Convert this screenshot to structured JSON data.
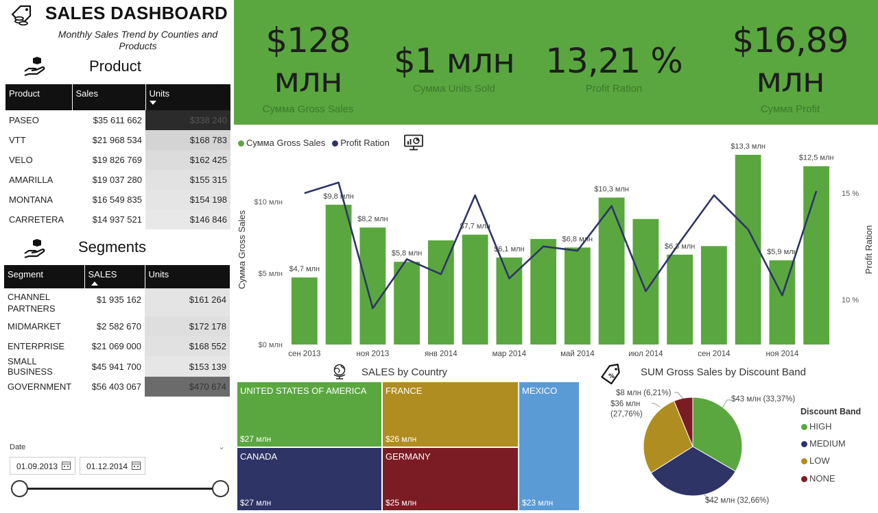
{
  "header": {
    "title": "SALES DASHBOARD",
    "subtitle": "Monthly Sales Trend by Counties and Products"
  },
  "product_section": {
    "title": "Product",
    "columns": [
      "Product",
      "Sales",
      "Units"
    ],
    "rows": [
      {
        "product": "PASEO",
        "sales": "$35 611 662",
        "units": "$338 240"
      },
      {
        "product": "VTT",
        "sales": "$21 968 534",
        "units": "$168 783"
      },
      {
        "product": "VELO",
        "sales": "$19 826 769",
        "units": "$162 425"
      },
      {
        "product": "AMARILLA",
        "sales": "$19 037 280",
        "units": "$155 315"
      },
      {
        "product": "MONTANA",
        "sales": "$16 549 835",
        "units": "$154 198"
      },
      {
        "product": "CARRETERA",
        "sales": "$14 937 521",
        "units": "$146 846"
      }
    ]
  },
  "segment_section": {
    "title": "Segments",
    "columns": [
      "Segment",
      "SALES",
      "Units"
    ],
    "rows": [
      {
        "segment": "CHANNEL PARTNERS",
        "sales": "$1 935 162",
        "units": "$161 264"
      },
      {
        "segment": "MIDMARKET",
        "sales": "$2 582 670",
        "units": "$172 178"
      },
      {
        "segment": "ENTERPRISE",
        "sales": "$21 069 000",
        "units": "$168 552"
      },
      {
        "segment": "SMALL BUSINESS",
        "sales": "$45 941 700",
        "units": "$153 139"
      },
      {
        "segment": "GOVERNMENT",
        "sales": "$56 403 067",
        "units": "$470 674"
      }
    ]
  },
  "date_slicer": {
    "label": "Date",
    "start": "01.09.2013",
    "end": "01.12.2014"
  },
  "kpis": [
    {
      "value_line1": "$128",
      "value_line2": "млн",
      "label": "Сумма Gross Sales"
    },
    {
      "value_line1": "$1 млн",
      "value_line2": "",
      "label": "Сумма Units Sold"
    },
    {
      "value_line1": "13,21 %",
      "value_line2": "",
      "label": "Profit Ration"
    },
    {
      "value_line1": "$16,89",
      "value_line2": "млн",
      "label": "Сумма Profit"
    }
  ],
  "colors": {
    "green": "#5aa73f",
    "navy": "#2e3466",
    "gold": "#b08d20",
    "maroon": "#7b1c24",
    "blue": "#5b9bd5"
  },
  "chart_data": [
    {
      "type": "bar+line",
      "legend": [
        "Сумма Gross Sales",
        "Profit Ration"
      ],
      "ylabel": "Сумма Gross Sales",
      "y2label": "Profit Ration",
      "y_ticks": [
        "$0 млн",
        "$5 млн",
        "$10 млн"
      ],
      "y2_ticks": [
        "10 %",
        "15 %"
      ],
      "ylim": [
        0,
        13.3
      ],
      "y2lim": [
        7.9,
        16.8
      ],
      "x_tick_labels": [
        "сен 2013",
        "ноя 2013",
        "янв 2014",
        "мар 2014",
        "май 2014",
        "июл 2014",
        "сен 2014",
        "ноя 2014"
      ],
      "categories": [
        "сен 2013",
        "окт 2013",
        "ноя 2013",
        "дек 2013",
        "янв 2014",
        "фев 2014",
        "мар 2014",
        "апр 2014",
        "май 2014",
        "июн 2014",
        "июл 2014",
        "авг 2014",
        "сен 2014",
        "окт 2014",
        "ноя 2014",
        "дек 2014"
      ],
      "series": [
        {
          "name": "Сумма Gross Sales",
          "kind": "bar",
          "values": [
            4.7,
            9.8,
            8.2,
            5.8,
            7.3,
            7.7,
            6.1,
            7.4,
            6.8,
            10.3,
            8.8,
            6.3,
            6.9,
            13.3,
            5.9,
            12.5
          ]
        },
        {
          "name": "Profit Ration",
          "kind": "line",
          "values": [
            15.0,
            15.5,
            9.6,
            11.9,
            11.2,
            14.9,
            11.0,
            12.5,
            12.3,
            14.4,
            10.4,
            12.7,
            14.9,
            13.3,
            10.2,
            15.1
          ]
        }
      ],
      "data_labels": [
        {
          "index": 0,
          "text": "$4,7 млн"
        },
        {
          "index": 1,
          "text": "$9,8 млн"
        },
        {
          "index": 2,
          "text": "$8,2 млн"
        },
        {
          "index": 3,
          "text": "$5,8 млн"
        },
        {
          "index": 5,
          "text": "$7,7 млн"
        },
        {
          "index": 6,
          "text": "$6,1 млн"
        },
        {
          "index": 8,
          "text": "$6,8 млн"
        },
        {
          "index": 9,
          "text": "$10,3 млн"
        },
        {
          "index": 11,
          "text": "$6,3 млн"
        },
        {
          "index": 13,
          "text": "$13,3 млн"
        },
        {
          "index": 14,
          "text": "$5,9 млн"
        },
        {
          "index": 15,
          "text": "$12,5 млн"
        }
      ]
    },
    {
      "type": "treemap",
      "title": "SALES by Country",
      "items": [
        {
          "name": "UNITED STATES OF AMERICA",
          "label": "$27 млн",
          "color": "#5aa73f"
        },
        {
          "name": "FRANCE",
          "label": "$26 млн",
          "color": "#b08d20"
        },
        {
          "name": "MEXICO",
          "label": "$23 млн",
          "color": "#5b9bd5"
        },
        {
          "name": "CANADA",
          "label": "$27 млн",
          "color": "#2e3466"
        },
        {
          "name": "GERMANY",
          "label": "$25 млн",
          "color": "#7b1c24"
        }
      ]
    },
    {
      "type": "pie",
      "title": "SUM Gross Sales by Discount Band",
      "legend_title": "Discount Band",
      "slices": [
        {
          "name": "HIGH",
          "value": 33.37,
          "label": "$43 млн (33,37%)",
          "color": "#5aa73f"
        },
        {
          "name": "MEDIUM",
          "value": 32.66,
          "label": "$42 млн (32,66%)",
          "color": "#2e3466"
        },
        {
          "name": "LOW",
          "value": 27.76,
          "label": "$36 млн (27,76%)",
          "color": "#b08d20"
        },
        {
          "name": "NONE",
          "value": 6.21,
          "label": "$8 млн (6,21%)",
          "color": "#7b1c24"
        }
      ]
    }
  ]
}
